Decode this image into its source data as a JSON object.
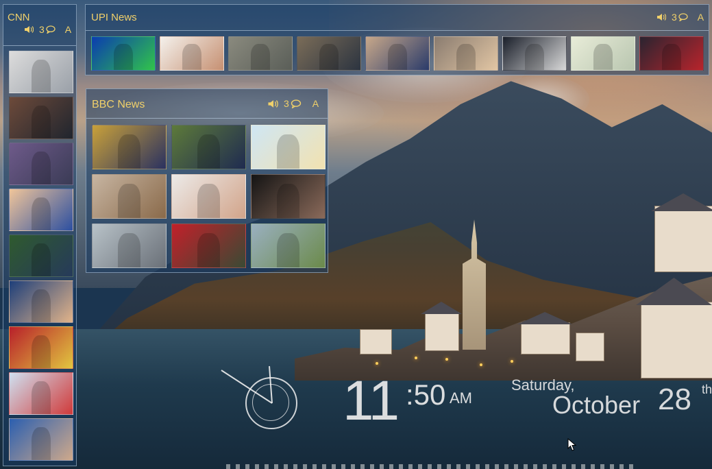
{
  "cnn": {
    "title": "CNN",
    "count": "3",
    "font_label": "A",
    "thumbs": [
      {
        "name": "document-photo",
        "colors": [
          "#dcdcdc",
          "#9aa0a8"
        ]
      },
      {
        "name": "men-in-suits",
        "colors": [
          "#6d4a3a",
          "#20252e"
        ]
      },
      {
        "name": "seated-officials",
        "colors": [
          "#6e5a8a",
          "#3a3b55"
        ]
      },
      {
        "name": "raised-hands",
        "colors": [
          "#f0c59a",
          "#2c4fa0"
        ]
      },
      {
        "name": "man-walking",
        "colors": [
          "#2f5a2e",
          "#263a5a"
        ]
      },
      {
        "name": "trump-speaking",
        "colors": [
          "#1e3f7a",
          "#e2b48a"
        ]
      },
      {
        "name": "crowd-flags",
        "colors": [
          "#b8202a",
          "#e1c640"
        ]
      },
      {
        "name": "skier",
        "colors": [
          "#cfe0f0",
          "#d03a3a"
        ]
      },
      {
        "name": "clinton-speaking",
        "colors": [
          "#2b5fb0",
          "#cfa98b"
        ]
      }
    ]
  },
  "upi": {
    "title": "UPI News",
    "count": "3",
    "font_label": "A",
    "thumbs": [
      {
        "name": "weather-radar",
        "colors": [
          "#0a3cb0",
          "#31c44a"
        ]
      },
      {
        "name": "man-portrait",
        "colors": [
          "#f4f1ec",
          "#c69072"
        ]
      },
      {
        "name": "helicopter-sky",
        "colors": [
          "#8a8a7e",
          "#5a5e58"
        ]
      },
      {
        "name": "protest-crowd",
        "colors": [
          "#7a6c58",
          "#2c3440"
        ]
      },
      {
        "name": "officials-meeting",
        "colors": [
          "#c8a88a",
          "#2a3b6a"
        ]
      },
      {
        "name": "celebrity-couple",
        "colors": [
          "#8a7c70",
          "#e2c6a4"
        ]
      },
      {
        "name": "man-tuxedo",
        "colors": [
          "#1a1f2a",
          "#d8d8d8"
        ]
      },
      {
        "name": "map",
        "colors": [
          "#e8ecd8",
          "#b9c6b0"
        ]
      },
      {
        "name": "red-carpet-group",
        "colors": [
          "#2a2430",
          "#b8242c"
        ]
      }
    ]
  },
  "bbc": {
    "title": "BBC News",
    "count": "3",
    "font_label": "A",
    "thumbs": [
      {
        "name": "speaker-podium-flags",
        "colors": [
          "#c9a13a",
          "#2a3160"
        ]
      },
      {
        "name": "man-glasses-trees",
        "colors": [
          "#5d7a3a",
          "#1f2b50"
        ]
      },
      {
        "name": "somalia-map",
        "colors": [
          "#cfe6f4",
          "#f2e2b0"
        ]
      },
      {
        "name": "man-on-rocks",
        "colors": [
          "#c7b5a2",
          "#8a6a4a"
        ]
      },
      {
        "name": "child-portrait",
        "colors": [
          "#eceae8",
          "#d2a48a"
        ]
      },
      {
        "name": "man-glasses-dark",
        "colors": [
          "#141414",
          "#8a6a5a"
        ]
      },
      {
        "name": "submarine-harbor",
        "colors": [
          "#b8c2c8",
          "#6a7078"
        ]
      },
      {
        "name": "soldier-red-cap",
        "colors": [
          "#c2202a",
          "#3a4a34"
        ]
      },
      {
        "name": "road-sign",
        "colors": [
          "#9ab0c0",
          "#6b8a4a"
        ]
      }
    ]
  },
  "clock": {
    "hour": "11",
    "minute": ":50",
    "ampm": "AM",
    "weekday": "Saturday,",
    "month": "October",
    "day": "28",
    "suffix": "th"
  }
}
